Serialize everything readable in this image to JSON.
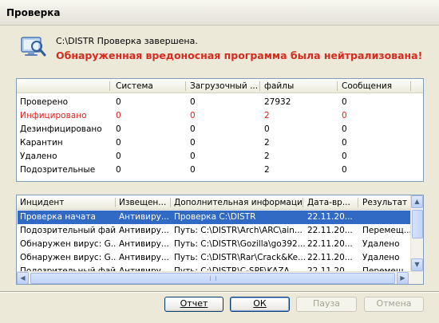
{
  "window": {
    "title": "Проверка"
  },
  "status": {
    "message": "C:\\DISTR Проверка завершена.",
    "alert": "Обнаруженная вредоносная программа была нейтрализована!",
    "alert_color": "#d62b1f"
  },
  "stats": {
    "columns": [
      "",
      "Система",
      "Загрузочный ...",
      "файлы",
      "Сообщения"
    ],
    "rows": [
      {
        "label": "Проверено",
        "values": [
          "0",
          "0",
          "27932",
          "0"
        ],
        "highlight": false
      },
      {
        "label": "Инфицировано",
        "values": [
          "0",
          "0",
          "2",
          "0"
        ],
        "highlight": true
      },
      {
        "label": "Дезинфицировано",
        "values": [
          "0",
          "0",
          "0",
          "0"
        ],
        "highlight": false
      },
      {
        "label": "Карантин",
        "values": [
          "0",
          "0",
          "2",
          "0"
        ],
        "highlight": false
      },
      {
        "label": "Удалено",
        "values": [
          "0",
          "0",
          "2",
          "0"
        ],
        "highlight": false
      },
      {
        "label": "Подозрительные",
        "values": [
          "0",
          "0",
          "2",
          "0"
        ],
        "highlight": false
      }
    ]
  },
  "incidents": {
    "columns": [
      "Инцидент",
      "Извещен...",
      "Дополнительная информация",
      "Дата-вр...",
      "Результат"
    ],
    "rows": [
      {
        "cells": [
          "Проверка начата",
          "Антивиру...",
          "Проверка C:\\DISTR",
          "22.11.20...",
          ""
        ],
        "selected": true
      },
      {
        "cells": [
          "Подозрительный файл",
          "Антивиру...",
          "Путь: C:\\DISTR\\Arch\\ARC\\ain...",
          "22.11.20...",
          "Перемещ..."
        ],
        "selected": false
      },
      {
        "cells": [
          "Обнаружен вирус: G...",
          "Антивиру...",
          "Путь: C:\\DISTR\\Gozilla\\go392....",
          "22.11.20...",
          "Удалено"
        ],
        "selected": false
      },
      {
        "cells": [
          "Обнаружен вирус: G...",
          "Антивиру...",
          "Путь: C:\\DISTR\\Rar\\Crack&Ke...",
          "22.11.20...",
          "Удалено"
        ],
        "selected": false
      },
      {
        "cells": [
          "Подозрительный файл",
          "Антивиру...",
          "Путь: C:\\DISTR\\C-SPF\\KAZA...",
          "22.11.20...",
          "Перемещ..."
        ],
        "selected": false
      }
    ]
  },
  "buttons": {
    "report": "Отчет",
    "ok": "ОК",
    "pause": "Пауза",
    "cancel": "Отмена"
  },
  "colors": {
    "selection": "#316ac5",
    "infected_text": "#e0201c"
  }
}
